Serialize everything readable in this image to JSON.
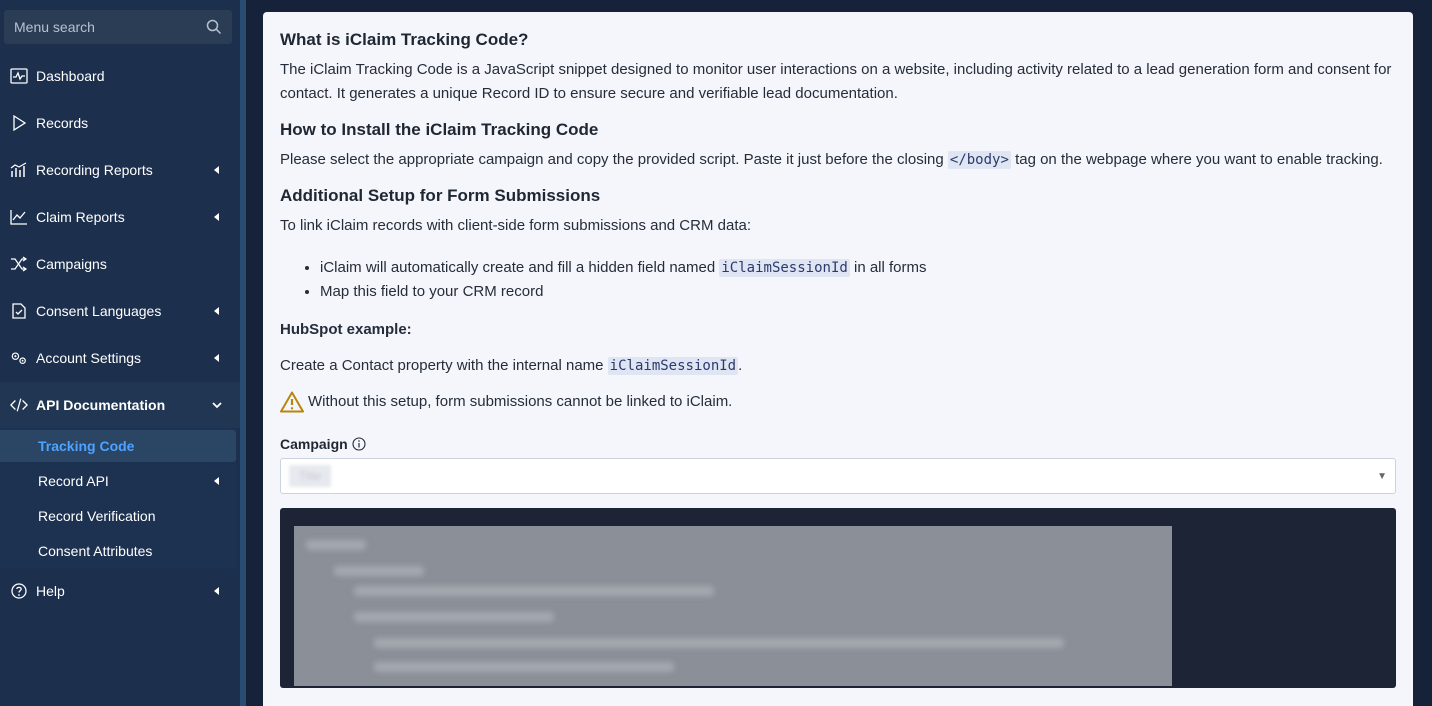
{
  "sidebar": {
    "search_placeholder": "Menu search",
    "items": [
      {
        "label": "Dashboard",
        "icon": "pulse-icon",
        "has_submenu": false
      },
      {
        "label": "Records",
        "icon": "play-icon",
        "has_submenu": false
      },
      {
        "label": "Recording Reports",
        "icon": "bar-chart-icon",
        "has_submenu": true
      },
      {
        "label": "Claim Reports",
        "icon": "line-chart-icon",
        "has_submenu": true
      },
      {
        "label": "Campaigns",
        "icon": "shuffle-icon",
        "has_submenu": false
      },
      {
        "label": "Consent Languages",
        "icon": "document-check-icon",
        "has_submenu": true
      },
      {
        "label": "Account Settings",
        "icon": "gears-icon",
        "has_submenu": true
      },
      {
        "label": "API Documentation",
        "icon": "code-icon",
        "has_submenu": true,
        "expanded": true
      },
      {
        "label": "Help",
        "icon": "question-icon",
        "has_submenu": true
      }
    ],
    "api_submenu": [
      {
        "label": "Tracking Code",
        "active": true
      },
      {
        "label": "Record API",
        "has_submenu": true
      },
      {
        "label": "Record Verification"
      },
      {
        "label": "Consent Attributes"
      }
    ]
  },
  "content": {
    "what_title": "What is iClaim Tracking Code?",
    "what_body": "The iClaim Tracking Code is a JavaScript snippet designed to monitor user interactions on a website, including activity related to a lead generation form and consent for contact. It generates a unique Record ID to ensure secure and verifiable lead documentation.",
    "install_title": "How to Install the iClaim Tracking Code",
    "install_before": "Please select the appropriate campaign and copy the provided script. Paste it just before the closing ",
    "install_code": "</body>",
    "install_after": " tag on the webpage where you want to enable tracking.",
    "setup_title": "Additional Setup for Form Submissions",
    "setup_body": "To link iClaim records with client-side form submissions and CRM data:",
    "bullet1_before": "iClaim will automatically create and fill a hidden field named ",
    "bullet1_code": "iClaimSessionId",
    "bullet1_after": " in all forms",
    "bullet2": "Map this field to your CRM record",
    "hubspot_title": "HubSpot example:",
    "hubspot_before": "Create a Contact property with the internal name ",
    "hubspot_code": "iClaimSessionId",
    "hubspot_after": ".",
    "warning": "Without this setup, form submissions cannot be linked to iClaim.",
    "campaign_label": "Campaign",
    "campaign_value": "Title"
  },
  "colors": {
    "sidebar_bg": "#1c2f4d",
    "active_link": "#4da3ff",
    "warning": "#b8860b",
    "code_bg": "#1c2436"
  }
}
